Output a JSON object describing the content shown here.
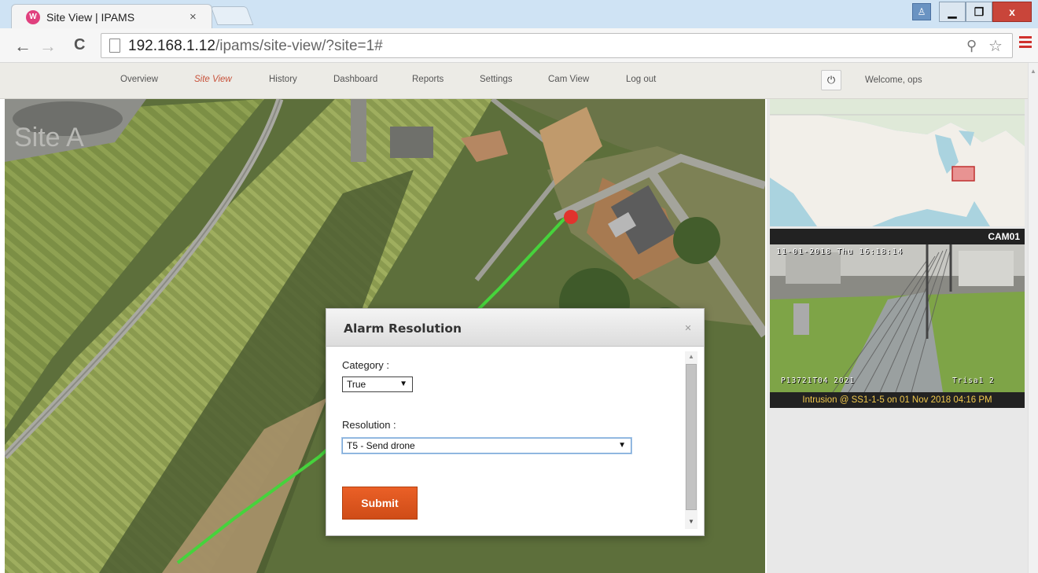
{
  "browser": {
    "tab_title": "Site View | IPAMS",
    "favicon_letter": "W",
    "close_glyph": "×",
    "url_host": "192.168.1.12",
    "url_path": "/ipams/site-view/?site=1#"
  },
  "nav": {
    "items": [
      {
        "label": "Overview"
      },
      {
        "label": "Site View",
        "active": true
      },
      {
        "label": "History"
      },
      {
        "label": "Dashboard"
      },
      {
        "label": "Reports"
      },
      {
        "label": "Settings"
      },
      {
        "label": "Cam View"
      },
      {
        "label": "Log out"
      }
    ],
    "welcome": "Welcome, ops"
  },
  "camera": {
    "name": "CAM01",
    "timestamp": "11-01-2018 Thu 16:18:14",
    "overlay_left": "P13721T04  2021",
    "overlay_right": "Trisa1 2",
    "caption": "Intrusion @ SS1-1-5 on 01 Nov 2018 04:16 PM"
  },
  "map": {
    "site_label": "Site A",
    "fence_color": "#46d33c",
    "alarm_color": "#e0332d"
  },
  "modal": {
    "title": "Alarm Resolution",
    "category_label": "Category :",
    "category_value": "True",
    "resolution_label": "Resolution :",
    "resolution_value": "T5 - Send drone",
    "submit_label": "Submit",
    "accent": "#e05a22"
  },
  "icons": {
    "back": "←",
    "forward": "→",
    "reload": "C",
    "zoom": "⚲",
    "star": "☆",
    "power": "⏻",
    "select_arrow": "▼",
    "close_x": "✕",
    "scroll_up": "▲",
    "scroll_down": "▼",
    "win_min": "▁",
    "win_max": "❐",
    "win_close": "x",
    "user": "♙"
  }
}
